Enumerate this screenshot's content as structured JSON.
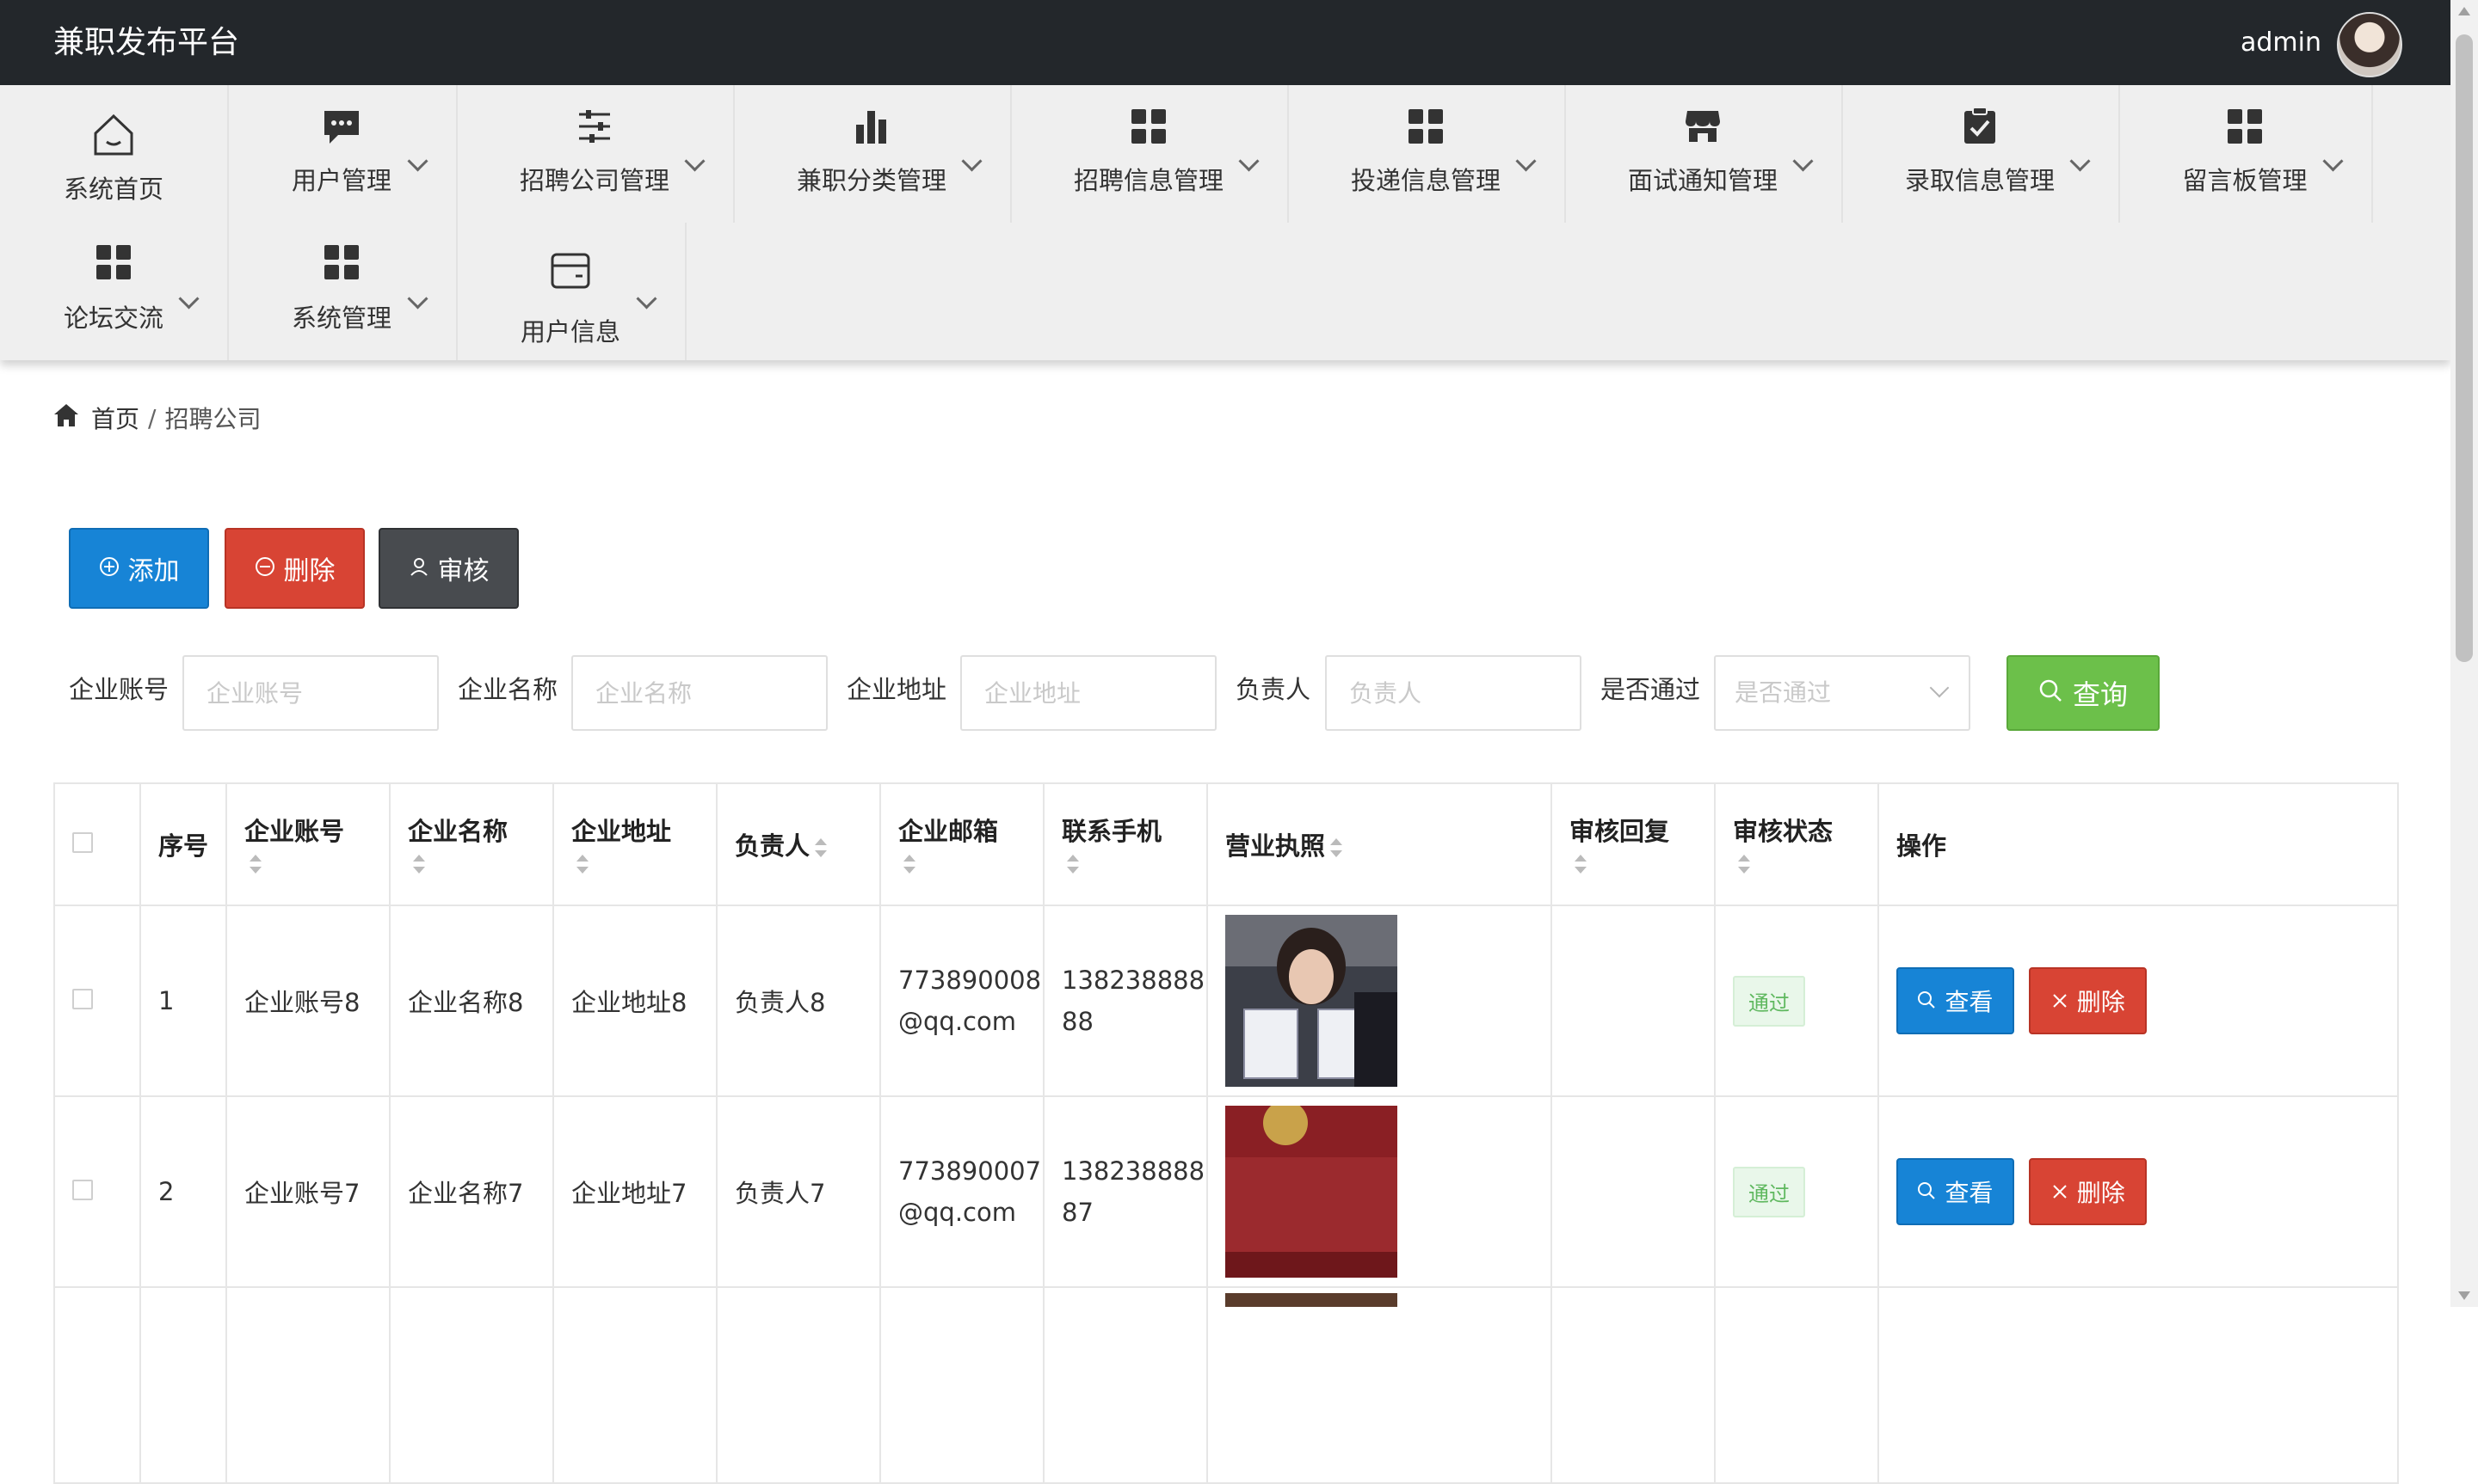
{
  "app": {
    "title": "兼职发布平台",
    "user": "admin"
  },
  "menu": {
    "items": [
      {
        "label": "系统首页",
        "icon": "home-icon"
      },
      {
        "label": "用户管理",
        "icon": "chat-icon"
      },
      {
        "label": "招聘公司管理",
        "icon": "sliders-icon"
      },
      {
        "label": "兼职分类管理",
        "icon": "bar-chart-icon"
      },
      {
        "label": "招聘信息管理",
        "icon": "grid-icon"
      },
      {
        "label": "投递信息管理",
        "icon": "grid-icon"
      },
      {
        "label": "面试通知管理",
        "icon": "store-icon"
      },
      {
        "label": "录取信息管理",
        "icon": "clipboard-check-icon"
      },
      {
        "label": "留言板管理",
        "icon": "grid-icon"
      },
      {
        "label": "论坛交流",
        "icon": "grid-icon"
      },
      {
        "label": "系统管理",
        "icon": "grid-icon"
      },
      {
        "label": "用户信息",
        "icon": "wallet-icon"
      }
    ]
  },
  "breadcrumb": {
    "home": "首页",
    "separator": "/",
    "current": "招聘公司"
  },
  "toolbar": {
    "add": "添加",
    "delete": "删除",
    "audit": "审核"
  },
  "search": {
    "fields": [
      {
        "label": "企业账号",
        "placeholder": "企业账号"
      },
      {
        "label": "企业名称",
        "placeholder": "企业名称"
      },
      {
        "label": "企业地址",
        "placeholder": "企业地址"
      },
      {
        "label": "负责人",
        "placeholder": "负责人"
      }
    ],
    "pass_label": "是否通过",
    "pass_placeholder": "是否通过",
    "query": "查询"
  },
  "table": {
    "headers": {
      "index": "序号",
      "account": "企业账号",
      "name": "企业名称",
      "address": "企业地址",
      "manager": "负责人",
      "email": "企业邮箱",
      "phone": "联系手机",
      "license": "营业执照",
      "reply": "审核回复",
      "status": "审核状态",
      "ops": "操作"
    },
    "rows": [
      {
        "index": "1",
        "account": "企业账号8",
        "name": "企业名称8",
        "address": "企业地址8",
        "manager": "负责人8",
        "email_line1": "773890008",
        "email_line2": "@qq.com",
        "phone_line1": "138238888",
        "phone_line2": "88",
        "reply": "",
        "status": "通过"
      },
      {
        "index": "2",
        "account": "企业账号7",
        "name": "企业名称7",
        "address": "企业地址7",
        "manager": "负责人7",
        "email_line1": "773890007",
        "email_line2": "@qq.com",
        "phone_line1": "138238888",
        "phone_line2": "87",
        "reply": "",
        "status": "通过"
      }
    ],
    "actions": {
      "view": "查看",
      "delete": "删除"
    }
  }
}
